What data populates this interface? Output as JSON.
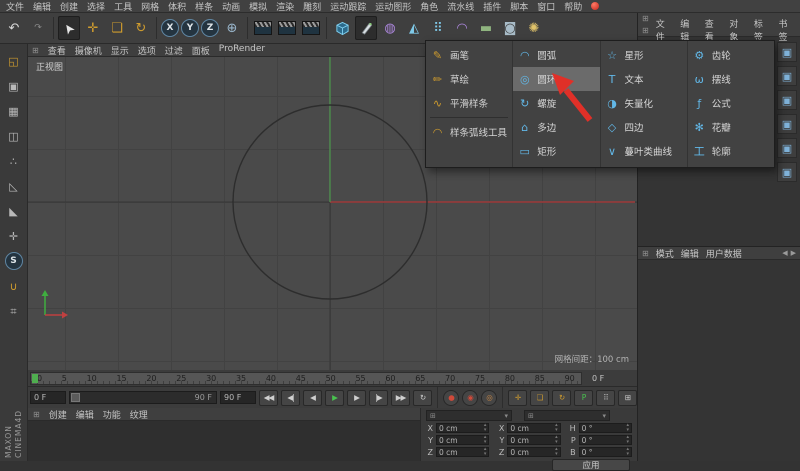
{
  "icons": {
    "panel_grip": "⊞",
    "chevron_down": "▾",
    "spinner_up": "▴",
    "spinner_down": "▾",
    "nav_left": "◀",
    "nav_right": "▶"
  },
  "colors": {
    "accent_cyan": "#62b8e8",
    "tool_gold": "#cf9c2e",
    "annotation_red": "#e03028",
    "axis_red": "#a03c3c",
    "axis_green": "#4f8f4f",
    "play_green": "#49c24f"
  },
  "menubar": {
    "items": [
      "文件",
      "编辑",
      "创建",
      "选择",
      "工具",
      "网格",
      "体积",
      "样条",
      "动画",
      "模拟",
      "渲染",
      "雕刻",
      "运动跟踪",
      "运动图形",
      "角色",
      "流水线",
      "插件",
      "脚本",
      "窗口",
      "帮助"
    ]
  },
  "toolbar": {
    "icons": [
      {
        "name": "undo-icon",
        "glyph": "↶",
        "color": "#d8d8d8"
      },
      {
        "name": "redo-icon",
        "glyph": "↷",
        "color": "#8a8a8a",
        "small": true
      },
      {
        "name": "separator"
      },
      {
        "name": "live-selection-tool",
        "glyph": "➤",
        "color": "#e6e6e6",
        "rotate": -125,
        "pressed": true
      },
      {
        "name": "move-tool",
        "glyph": "✛",
        "color": "#cf9c2e"
      },
      {
        "name": "scale-tool",
        "glyph": "❏",
        "color": "#cf9c2e"
      },
      {
        "name": "rotate-tool",
        "glyph": "↻",
        "color": "#cf9c2e"
      },
      {
        "name": "separator"
      },
      {
        "name": "x-axis-lock-button",
        "glyph": "X",
        "type": "circle"
      },
      {
        "name": "y-axis-lock-button",
        "glyph": "Y",
        "type": "circle"
      },
      {
        "name": "z-axis-lock-button",
        "glyph": "Z",
        "type": "circle"
      },
      {
        "name": "coordinate-system-button",
        "glyph": "⊕",
        "color": "#9bb8ce"
      },
      {
        "name": "separator"
      },
      {
        "name": "render-view-button",
        "type": "clapper"
      },
      {
        "name": "render-picture-viewer-button",
        "type": "clapper"
      },
      {
        "name": "render-settings-button",
        "type": "clapper"
      },
      {
        "name": "separator"
      },
      {
        "name": "add-cube-object-button",
        "type": "cube"
      },
      {
        "name": "pen-spline-button",
        "type": "pen",
        "pressed": true
      },
      {
        "name": "subdivision-surface-button",
        "glyph": "◍",
        "color": "#ae88df"
      },
      {
        "name": "extrude-generator-button",
        "glyph": "◭",
        "color": "#7fc9e8"
      },
      {
        "name": "array-generator-button",
        "glyph": "⠿",
        "color": "#7fc9e8"
      },
      {
        "name": "bend-deformer-button",
        "glyph": "◠",
        "color": "#ae88df"
      },
      {
        "name": "floor-environment-button",
        "glyph": "▬",
        "color": "#8fb47f"
      },
      {
        "name": "camera-button",
        "glyph": "◙",
        "color": "#a8bcc8"
      },
      {
        "name": "light-button",
        "glyph": "✺",
        "color": "#e0c36a"
      }
    ]
  },
  "left_toolbar": {
    "icons": [
      {
        "name": "make-editable-icon",
        "glyph": "◱",
        "color": "#cf9c2e"
      },
      {
        "name": "model-mode-icon",
        "glyph": "▣",
        "color": "#b9b9b9"
      },
      {
        "name": "texture-mode-icon",
        "glyph": "▦",
        "color": "#b9b9b9"
      },
      {
        "name": "workplane-mode-icon",
        "glyph": "◫",
        "color": "#b9b9b9"
      },
      {
        "name": "points-mode-icon",
        "glyph": "∴",
        "color": "#b9b9b9"
      },
      {
        "name": "edges-mode-icon",
        "glyph": "◺",
        "color": "#b9b9b9"
      },
      {
        "name": "polygons-mode-icon",
        "glyph": "◣",
        "color": "#b9b9b9"
      },
      {
        "name": "enable-axis-icon",
        "glyph": "✛",
        "color": "#b9b9b9"
      },
      {
        "name": "solo-mode-icon",
        "glyph": "S",
        "type": "circle"
      },
      {
        "name": "enable-snap-icon",
        "glyph": "∪",
        "color": "#cf9c2e"
      },
      {
        "name": "lock-workplane-icon",
        "glyph": "⌗",
        "color": "#b9b9b9"
      }
    ]
  },
  "right_strip": {
    "icons": [
      {
        "name": "palette-cube-icon-1",
        "glyph": "▣"
      },
      {
        "name": "palette-cube-icon-2",
        "glyph": "▣"
      },
      {
        "name": "palette-cube-icon-3",
        "glyph": "▣"
      },
      {
        "name": "palette-cube-icon-4",
        "glyph": "▣"
      },
      {
        "name": "palette-cube-icon-5",
        "glyph": "▣"
      },
      {
        "name": "palette-cube-icon-6",
        "glyph": "▣"
      }
    ]
  },
  "viewport": {
    "menu_items": [
      "查看",
      "摄像机",
      "显示",
      "选项",
      "过滤",
      "面板",
      "ProRender"
    ],
    "view_label": "正视图",
    "grid_spacing": "网格间距：100 cm"
  },
  "spline_menu": {
    "tools": [
      {
        "label": "画笔",
        "glyph": "✎",
        "icon": "pen-icon"
      },
      {
        "label": "草绘",
        "glyph": "✏",
        "icon": "sketch-icon"
      },
      {
        "label": "平滑样条",
        "glyph": "∿",
        "icon": "spline-smooth-icon"
      },
      {
        "label": "样条弧线工具",
        "glyph": "◠",
        "icon": "spline-arc-tool-icon"
      }
    ],
    "primitives": [
      [
        {
          "label": "圆弧",
          "glyph": "◠",
          "icon": "arc-icon"
        },
        {
          "label": "圆环",
          "glyph": "◎",
          "icon": "circle-icon",
          "highlighted": true
        },
        {
          "label": "螺旋",
          "glyph": "↻",
          "icon": "helix-icon"
        },
        {
          "label": "多边",
          "glyph": "⌂",
          "icon": "n-side-icon"
        },
        {
          "label": "矩形",
          "glyph": "▭",
          "icon": "rectangle-icon"
        }
      ],
      [
        {
          "label": "星形",
          "glyph": "☆",
          "icon": "star-icon"
        },
        {
          "label": "文本",
          "glyph": "T",
          "icon": "text-icon"
        },
        {
          "label": "矢量化",
          "glyph": "◑",
          "icon": "vectorizer-icon"
        },
        {
          "label": "四边",
          "glyph": "◇",
          "icon": "four-side-icon"
        },
        {
          "label": "蔓叶类曲线",
          "glyph": "∨",
          "icon": "cissoid-icon"
        }
      ],
      [
        {
          "label": "齿轮",
          "glyph": "⚙",
          "icon": "cogwheel-icon"
        },
        {
          "label": "摆线",
          "glyph": "ω",
          "icon": "cycloid-icon"
        },
        {
          "label": "公式",
          "glyph": "ƒ",
          "icon": "formula-icon"
        },
        {
          "label": "花瓣",
          "glyph": "✻",
          "icon": "flower-icon"
        },
        {
          "label": "轮廓",
          "glyph": "工",
          "icon": "profile-icon"
        }
      ]
    ]
  },
  "object_manager": {
    "menu_items": [
      "文件",
      "编辑",
      "查看",
      "对象",
      "标签",
      "书签"
    ]
  },
  "attribute_manager": {
    "menu_items": [
      "模式",
      "编辑",
      "用户数据"
    ]
  },
  "material_manager": {
    "menu_items": [
      "创建",
      "编辑",
      "功能",
      "纹理"
    ]
  },
  "timeline": {
    "ticks": [
      "0",
      "5",
      "10",
      "15",
      "20",
      "25",
      "30",
      "35",
      "40",
      "45",
      "50",
      "55",
      "60",
      "65",
      "70",
      "75",
      "80",
      "85",
      "90"
    ],
    "frame_label": "0 F"
  },
  "transport": {
    "start_value": "0 F",
    "slider_label": "90 F",
    "end_value": "90 F",
    "buttons": [
      {
        "name": "go-to-start-button",
        "glyph": "◀◀"
      },
      {
        "name": "previous-key-button",
        "glyph": "◀|"
      },
      {
        "name": "previous-frame-button",
        "glyph": "◀"
      },
      {
        "name": "play-button",
        "glyph": "▶",
        "color": "#49c24f"
      },
      {
        "name": "next-frame-button",
        "glyph": "▶"
      },
      {
        "name": "next-key-button",
        "glyph": "|▶"
      },
      {
        "name": "go-to-end-button",
        "glyph": "▶▶"
      },
      {
        "name": "loop-button",
        "glyph": "↻"
      }
    ],
    "record_buttons": [
      {
        "name": "record-keyframe-button",
        "glyph": "●",
        "color": "#d04a3a"
      },
      {
        "name": "autokey-button",
        "glyph": "◉",
        "color": "#d04a3a"
      },
      {
        "name": "record-options-button",
        "glyph": "◎",
        "color": "#cc8844"
      }
    ],
    "key_buttons": [
      {
        "name": "keyframe-position-button",
        "glyph": "✛",
        "color": "#cf9c2e"
      },
      {
        "name": "keyframe-scale-button",
        "glyph": "❏",
        "color": "#cf9c2e"
      },
      {
        "name": "keyframe-rotation-button",
        "glyph": "↻",
        "color": "#cf9c2e"
      },
      {
        "name": "keyframe-parameter-button",
        "glyph": "P",
        "color": "#49c24f"
      },
      {
        "name": "keyframe-grid-button",
        "glyph": "⠿",
        "color": "#bbbbbb"
      }
    ],
    "layout_button": {
      "name": "timeline-panel-button",
      "glyph": "⊞"
    }
  },
  "coordinates": {
    "rows": [
      {
        "cells": [
          {
            "label": "X",
            "value": "0 cm"
          },
          {
            "label": "X",
            "value": "0 cm"
          },
          {
            "label": "H",
            "value": "0 °"
          }
        ]
      },
      {
        "cells": [
          {
            "label": "Y",
            "value": "0 cm"
          },
          {
            "label": "Y",
            "value": "0 cm"
          },
          {
            "label": "P",
            "value": "0 °"
          }
        ]
      },
      {
        "cells": [
          {
            "label": "Z",
            "value": "0 cm"
          },
          {
            "label": "Z",
            "value": "0 cm"
          },
          {
            "label": "B",
            "value": "0 °"
          }
        ]
      }
    ],
    "apply_label": "应用"
  },
  "branding": {
    "line1": "MAXON",
    "line2": "CINEMA4D"
  }
}
